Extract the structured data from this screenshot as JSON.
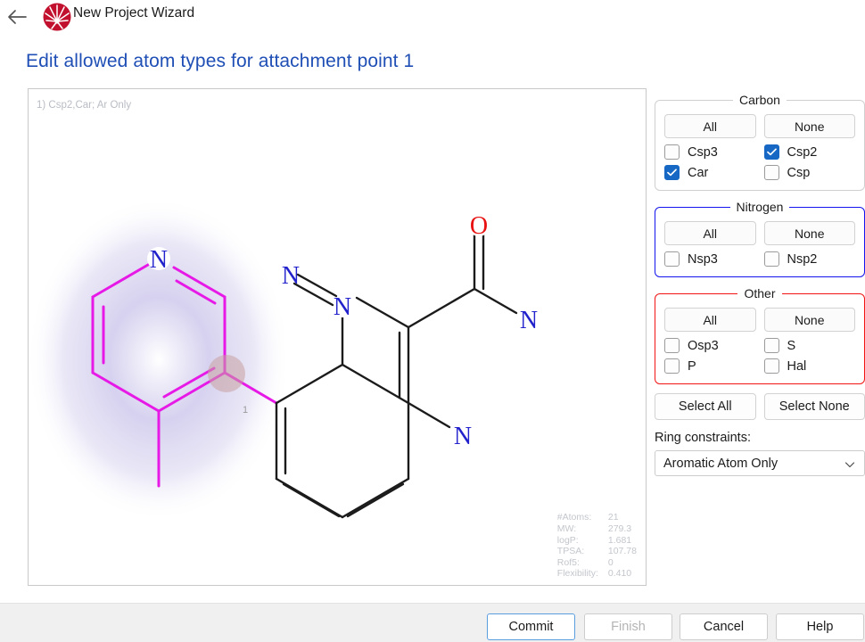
{
  "titlebar": {
    "back_icon": "back-arrow-icon",
    "logo_icon": "starburst-logo-icon",
    "app_title": "New Project Wizard"
  },
  "page_title": "Edit allowed atom types for attachment point 1",
  "canvas": {
    "label": "1) Csp2,Car; Ar Only",
    "attachment_marker": "1",
    "properties": [
      {
        "key": "#Atoms:",
        "value": "21"
      },
      {
        "key": "MW:",
        "value": "279.3"
      },
      {
        "key": "logP:",
        "value": "1.681"
      },
      {
        "key": "TPSA:",
        "value": "107.78"
      },
      {
        "key": "Rof5:",
        "value": "0"
      },
      {
        "key": "Flexibility:",
        "value": "0.410"
      }
    ],
    "atom_labels": {
      "pyridine_n": "N",
      "cinnoline_n1": "N",
      "cinnoline_n2": "N",
      "amide_o": "O",
      "amide_n": "N",
      "amine_n": "N"
    },
    "colors": {
      "highlight_bond": "#e619e6",
      "highlight_glow": "#c9c4ea",
      "nitrogen": "#2222cc",
      "oxygen": "#e81010",
      "bond": "#1b1b1b",
      "attachment_dot": "#c9a0a0"
    }
  },
  "options": {
    "groups": [
      {
        "legend": "Carbon",
        "border": "gray",
        "all_label": "All",
        "none_label": "None",
        "checkboxes": [
          {
            "label": "Csp3",
            "checked": false
          },
          {
            "label": "Csp2",
            "checked": true
          },
          {
            "label": "Car",
            "checked": true
          },
          {
            "label": "Csp",
            "checked": false
          }
        ]
      },
      {
        "legend": "Nitrogen",
        "border": "blue",
        "all_label": "All",
        "none_label": "None",
        "checkboxes": [
          {
            "label": "Nsp3",
            "checked": false
          },
          {
            "label": "Nsp2",
            "checked": false
          }
        ]
      },
      {
        "legend": "Other",
        "border": "red",
        "all_label": "All",
        "none_label": "None",
        "checkboxes": [
          {
            "label": "Osp3",
            "checked": false
          },
          {
            "label": "S",
            "checked": false
          },
          {
            "label": "P",
            "checked": false
          },
          {
            "label": "Hal",
            "checked": false
          }
        ]
      }
    ],
    "select_all_label": "Select All",
    "select_none_label": "Select None",
    "ring_constraints_label": "Ring constraints:",
    "ring_constraints_value": "Aromatic Atom Only",
    "ring_constraints_chevron": "chevron-down-icon"
  },
  "footer": {
    "commit": "Commit",
    "finish": "Finish",
    "cancel": "Cancel",
    "help": "Help"
  },
  "colors": {
    "accent_blue": "#1f4fb5",
    "checkbox_blue": "#1668c4",
    "group_blue": "#1414ee",
    "group_red": "#f21414",
    "logo_red": "#c2112e",
    "footer_bg": "#f0f0f0"
  }
}
